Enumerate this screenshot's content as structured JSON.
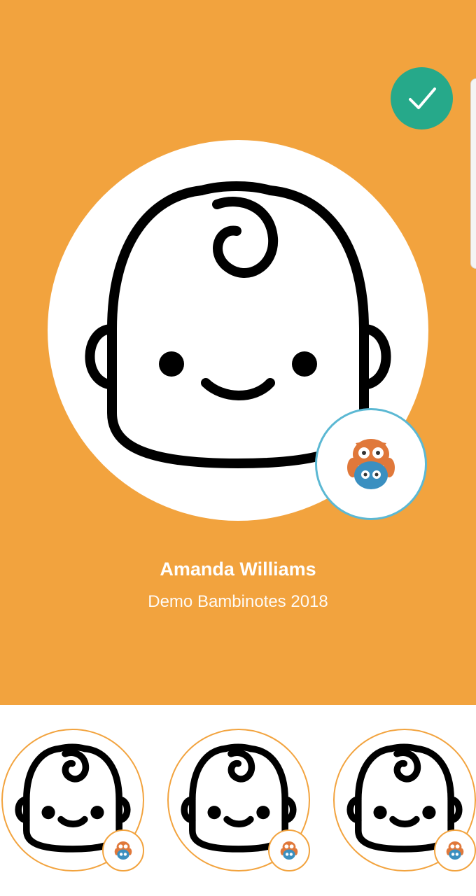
{
  "profile": {
    "name": "Amanda Williams",
    "subtitle": "Demo Bambinotes 2018"
  },
  "icons": {
    "confirm": "checkmark-icon",
    "avatar": "baby-face-icon",
    "badge": "owl-logo-icon"
  },
  "colors": {
    "hero_background": "#F2A33E",
    "confirm_button": "#26A98A",
    "badge_ring": "#5BB8D3",
    "owl_orange": "#E0783A",
    "owl_blue": "#3A8FC0"
  },
  "thumbnails": [
    {
      "icon": "baby-face-icon"
    },
    {
      "icon": "baby-face-icon"
    },
    {
      "icon": "baby-face-icon"
    }
  ]
}
